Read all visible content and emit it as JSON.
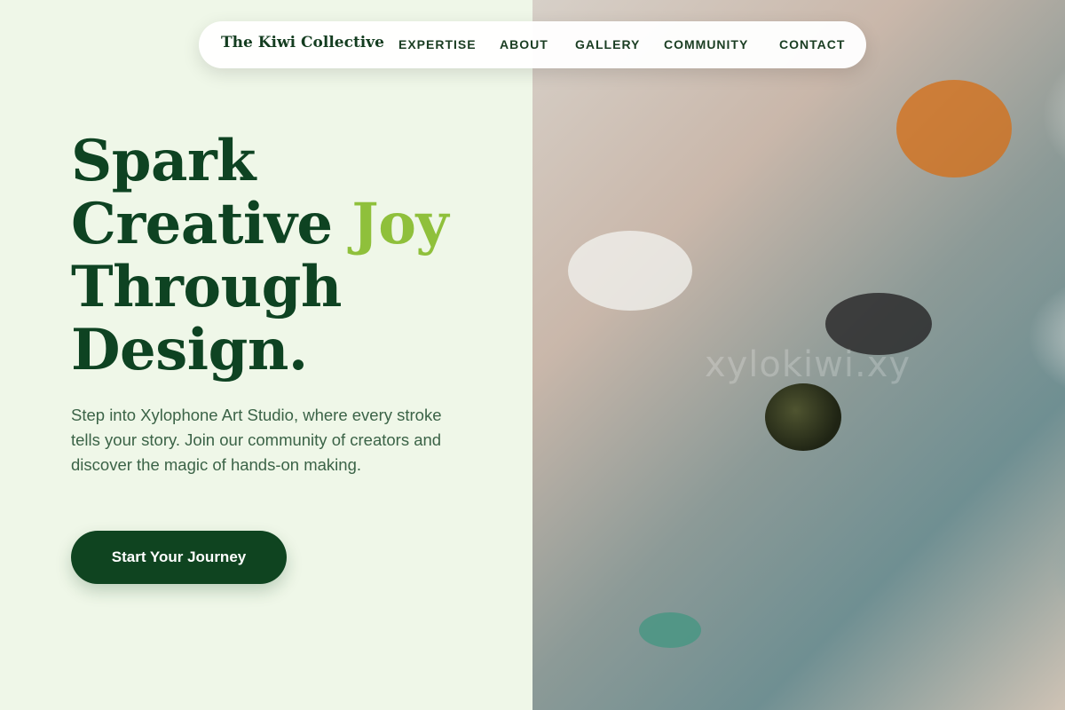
{
  "brand": {
    "name": "The Kiwi Collective"
  },
  "nav": {
    "items": [
      {
        "label": "EXPERTISE"
      },
      {
        "label": "ABOUT"
      },
      {
        "label": "GALLERY"
      },
      {
        "label": "COMMUNITY"
      },
      {
        "label": "CONTACT"
      }
    ]
  },
  "hero": {
    "title_line1": "Spark",
    "title_line2_a": "Creative ",
    "title_line2_b": "Joy",
    "title_line3": "Through",
    "title_line4": "Design.",
    "description": "Step into Xylophone Art Studio, where every stroke tells your story. Join our community of creators and discover the magic of hands-on making.",
    "cta_label": "Start Your Journey"
  },
  "art": {
    "watermark": "xylokiwi.xy"
  },
  "colors": {
    "background": "#eff7e8",
    "primary": "#0f4420",
    "accent": "#8fc03b",
    "body_text": "#3b6347"
  }
}
